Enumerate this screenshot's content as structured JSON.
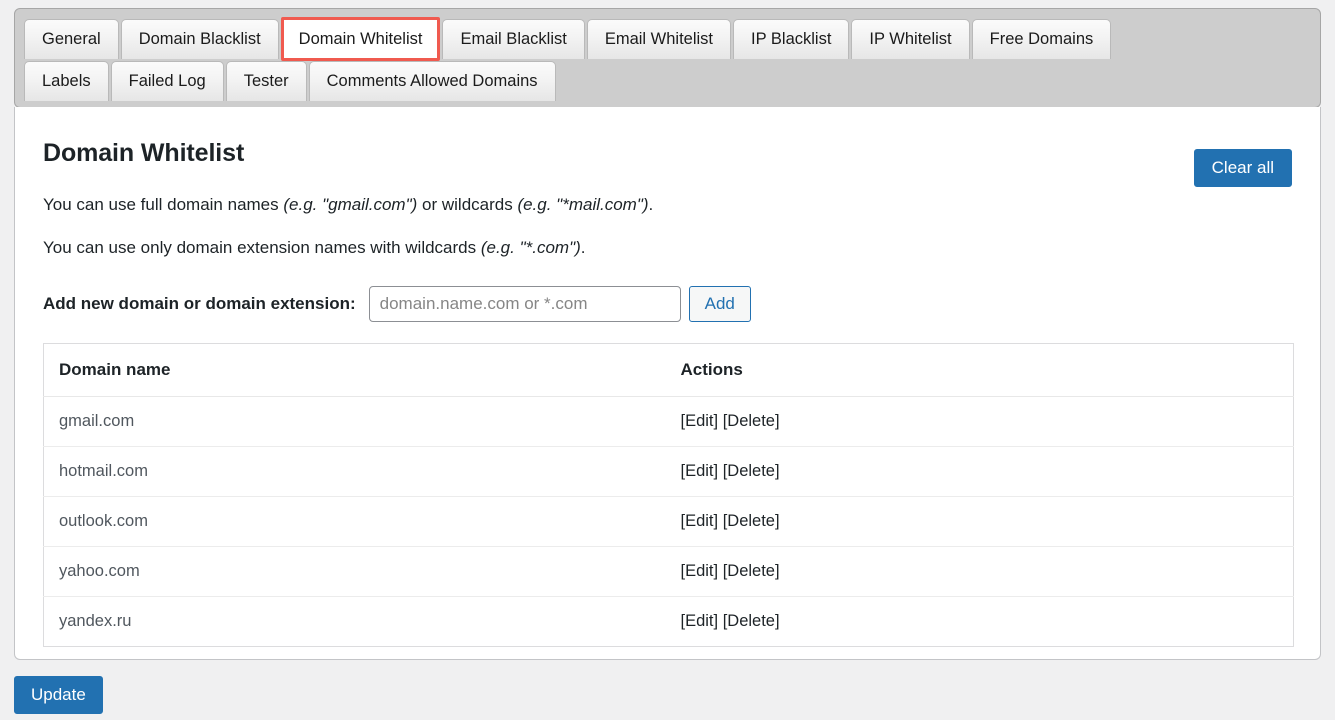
{
  "tabs": {
    "row1": [
      {
        "label": "General",
        "active": false
      },
      {
        "label": "Domain Blacklist",
        "active": false
      },
      {
        "label": "Domain Whitelist",
        "active": true
      },
      {
        "label": "Email Blacklist",
        "active": false
      },
      {
        "label": "Email Whitelist",
        "active": false
      },
      {
        "label": "IP Blacklist",
        "active": false
      },
      {
        "label": "IP Whitelist",
        "active": false
      },
      {
        "label": "Free Domains",
        "active": false
      }
    ],
    "row2": [
      {
        "label": "Labels",
        "active": false
      },
      {
        "label": "Failed Log",
        "active": false
      },
      {
        "label": "Tester",
        "active": false
      },
      {
        "label": "Comments Allowed Domains",
        "active": false
      }
    ]
  },
  "page": {
    "title": "Domain Whitelist",
    "clear_all_label": "Clear all",
    "hint_1_prefix": "You can use full domain names ",
    "hint_1_em1": "(e.g. \"gmail.com\")",
    "hint_1_mid": " or wildcards ",
    "hint_1_em2": "(e.g. \"*mail.com\")",
    "hint_1_suffix": ".",
    "hint_2_prefix": "You can use only domain extension names with wildcards ",
    "hint_2_em1": "(e.g. \"*.com\")",
    "hint_2_suffix": ".",
    "add_label": "Add new domain or domain extension:",
    "add_placeholder": "domain.name.com or *.com",
    "add_value": "",
    "add_button_label": "Add",
    "update_label": "Update"
  },
  "table": {
    "headers": {
      "domain": "Domain name",
      "actions": "Actions"
    },
    "rows": [
      {
        "domain": "gmail.com",
        "edit": "[Edit]",
        "delete": "[Delete]"
      },
      {
        "domain": "hotmail.com",
        "edit": "[Edit]",
        "delete": "[Delete]"
      },
      {
        "domain": "outlook.com",
        "edit": "[Edit]",
        "delete": "[Delete]"
      },
      {
        "domain": "yahoo.com",
        "edit": "[Edit]",
        "delete": "[Delete]"
      },
      {
        "domain": "yandex.ru",
        "edit": "[Edit]",
        "delete": "[Delete]"
      }
    ]
  },
  "colors": {
    "accent_blue": "#2271b1",
    "active_tab_outline": "#f05a4f",
    "tabbar_bg": "#cdcdcd",
    "page_bg": "#f0f0f1",
    "text": "#1d2327",
    "muted_text": "#646970"
  }
}
